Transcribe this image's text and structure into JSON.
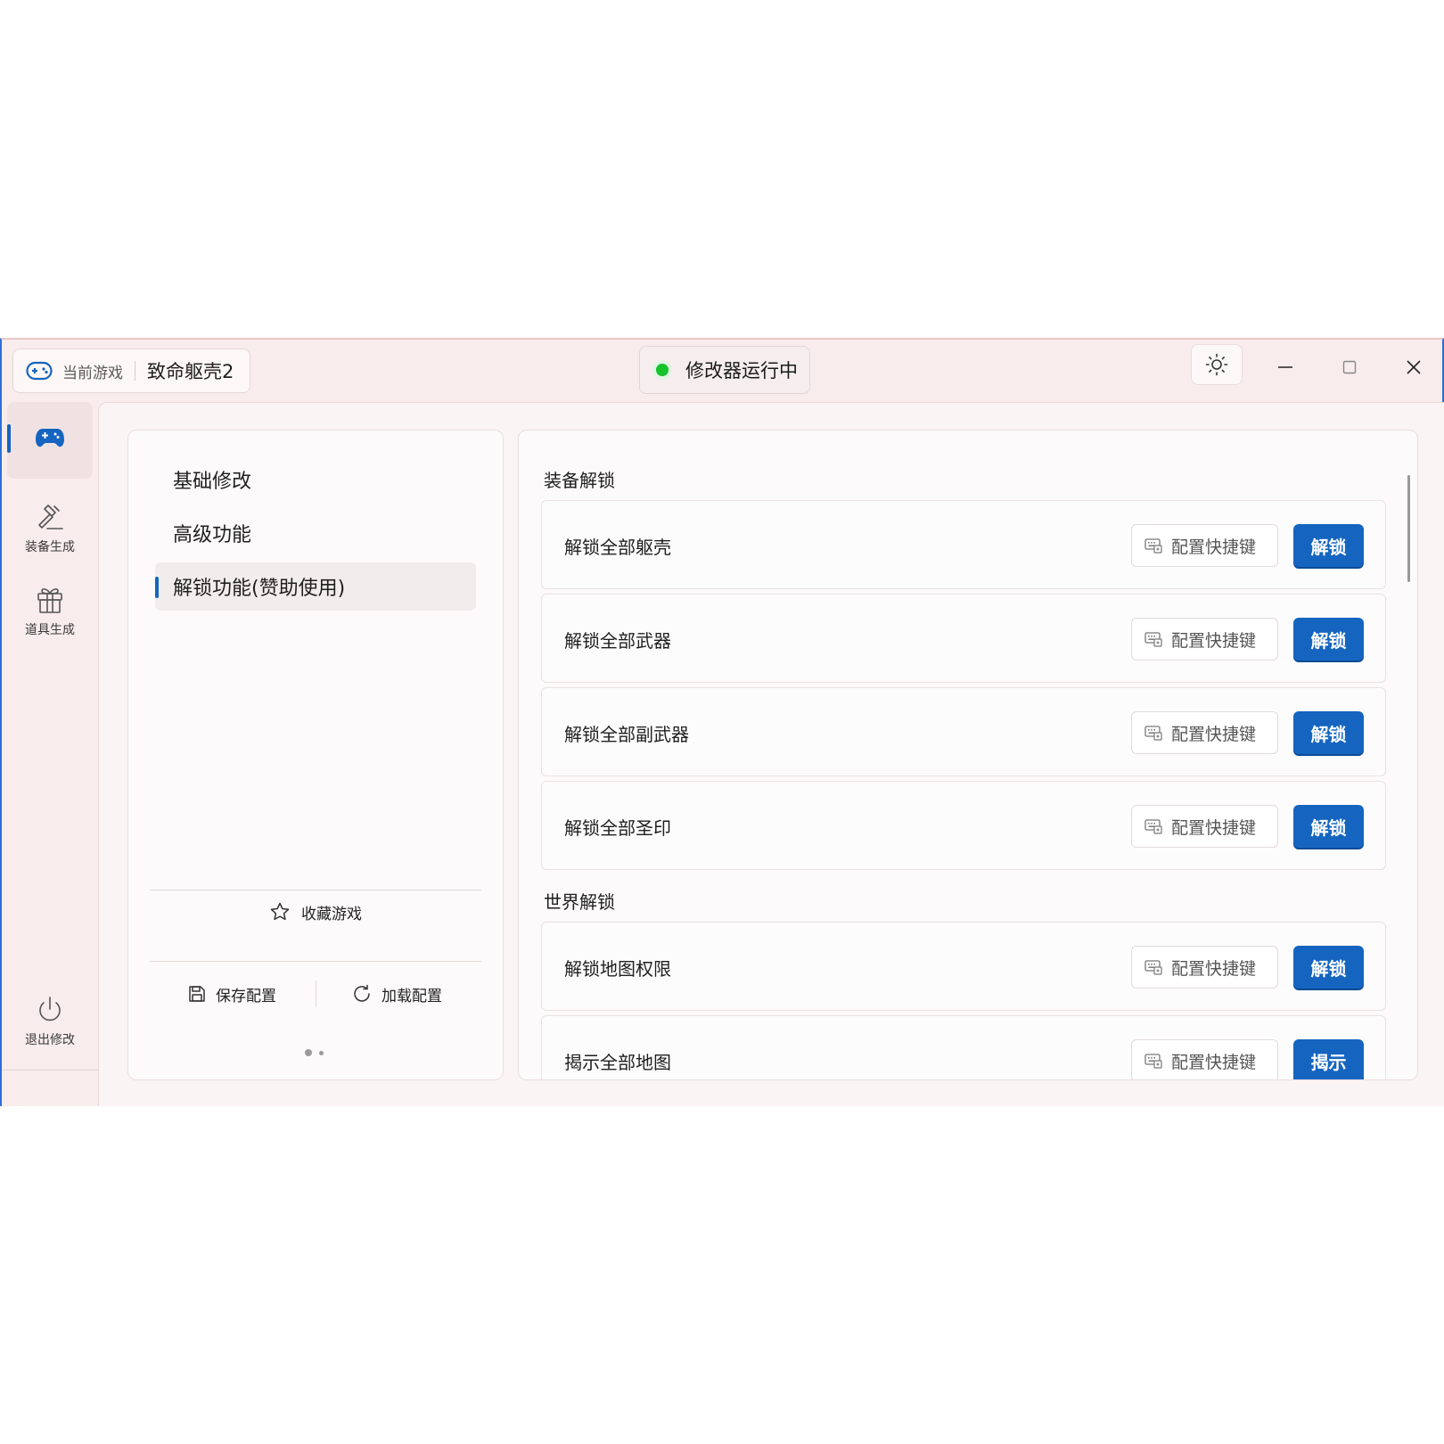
{
  "titlebar": {
    "current_game_label": "当前游戏",
    "game_name": "致命躯壳2",
    "status_text": "修改器运行中",
    "status_color": "#14c22a"
  },
  "sidebar": {
    "items": [
      {
        "label": "",
        "icon": "gamepad-icon"
      },
      {
        "label": "装备生成",
        "icon": "hammer-icon"
      },
      {
        "label": "道具生成",
        "icon": "gift-icon"
      }
    ],
    "exit_label": "退出修改"
  },
  "menu": {
    "items": [
      {
        "label": "基础修改"
      },
      {
        "label": "高级功能"
      },
      {
        "label": "解锁功能(赞助使用)"
      }
    ],
    "favorite_label": "收藏游戏",
    "save_label": "保存配置",
    "load_label": "加载配置"
  },
  "sections": [
    {
      "title": "装备解锁",
      "rows": [
        {
          "label": "解锁全部躯壳",
          "hotkey_label": "配置快捷键",
          "action_label": "解锁"
        },
        {
          "label": "解锁全部武器",
          "hotkey_label": "配置快捷键",
          "action_label": "解锁"
        },
        {
          "label": "解锁全部副武器",
          "hotkey_label": "配置快捷键",
          "action_label": "解锁"
        },
        {
          "label": "解锁全部圣印",
          "hotkey_label": "配置快捷键",
          "action_label": "解锁"
        }
      ]
    },
    {
      "title": "世界解锁",
      "rows": [
        {
          "label": "解锁地图权限",
          "hotkey_label": "配置快捷键",
          "action_label": "解锁"
        },
        {
          "label": "揭示全部地图",
          "hotkey_label": "配置快捷键",
          "action_label": "揭示"
        }
      ]
    }
  ],
  "colors": {
    "accent": "#1565c0",
    "window_bg": "#f9ecec",
    "panel_bg": "#fcfafa"
  }
}
